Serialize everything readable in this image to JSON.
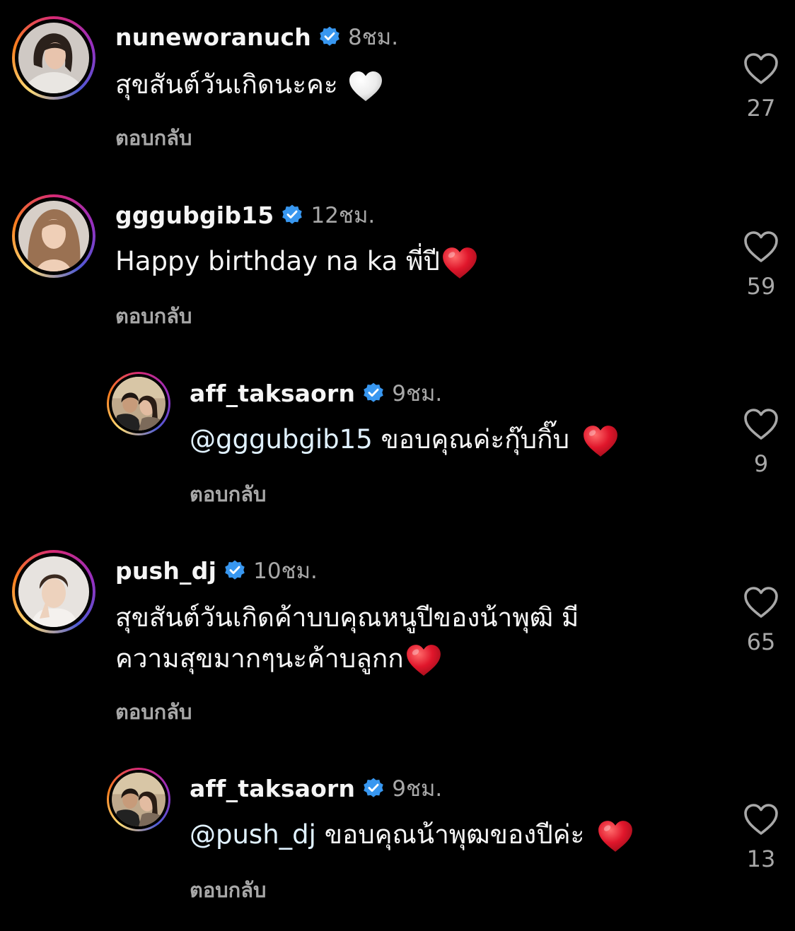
{
  "colors": {
    "background": "#000000",
    "text": "#f5f5f5",
    "muted": "#a8a8a8",
    "verified": "#3897f0",
    "heart_red": "#e0162b",
    "mention": "#e0f1ff"
  },
  "comments": [
    {
      "username": "nuneworanuch",
      "verified": true,
      "time": "8ชม.",
      "text": "สุขสันต์วันเกิดนะคะ",
      "emoji": "white-heart",
      "reply_label": "ตอบกลับ",
      "likes": "27",
      "is_reply": false
    },
    {
      "username": "gggubgib15",
      "verified": true,
      "time": "12ชม.",
      "text": "Happy birthday na ka พี่ปี",
      "emoji": "red-heart",
      "reply_label": "ตอบกลับ",
      "likes": "59",
      "is_reply": false
    },
    {
      "username": "aff_taksaorn",
      "verified": true,
      "time": "9ชม.",
      "mention": "@gggubgib15",
      "text": "ขอบคุณค่ะกุ๊บกิ๊บ",
      "emoji": "red-heart",
      "reply_label": "ตอบกลับ",
      "likes": "9",
      "is_reply": true
    },
    {
      "username": "push_dj",
      "verified": true,
      "time": "10ชม.",
      "text_line1": "สุขสันต์วันเกิดค้าบบคุณหนูปีของน้าพุฒิ มี",
      "text_line2": "ความสุขมากๆนะค้าบลูกก",
      "emoji": "red-heart",
      "reply_label": "ตอบกลับ",
      "likes": "65",
      "is_reply": false
    },
    {
      "username": "aff_taksaorn",
      "verified": true,
      "time": "9ชม.",
      "mention": "@push_dj",
      "text": "ขอบคุณน้าพุฒของปีค่ะ",
      "emoji": "red-heart",
      "reply_label": "ตอบกลับ",
      "likes": "13",
      "is_reply": true
    }
  ],
  "icons": {
    "verified": "verified-badge-icon",
    "like": "heart-outline-icon"
  }
}
